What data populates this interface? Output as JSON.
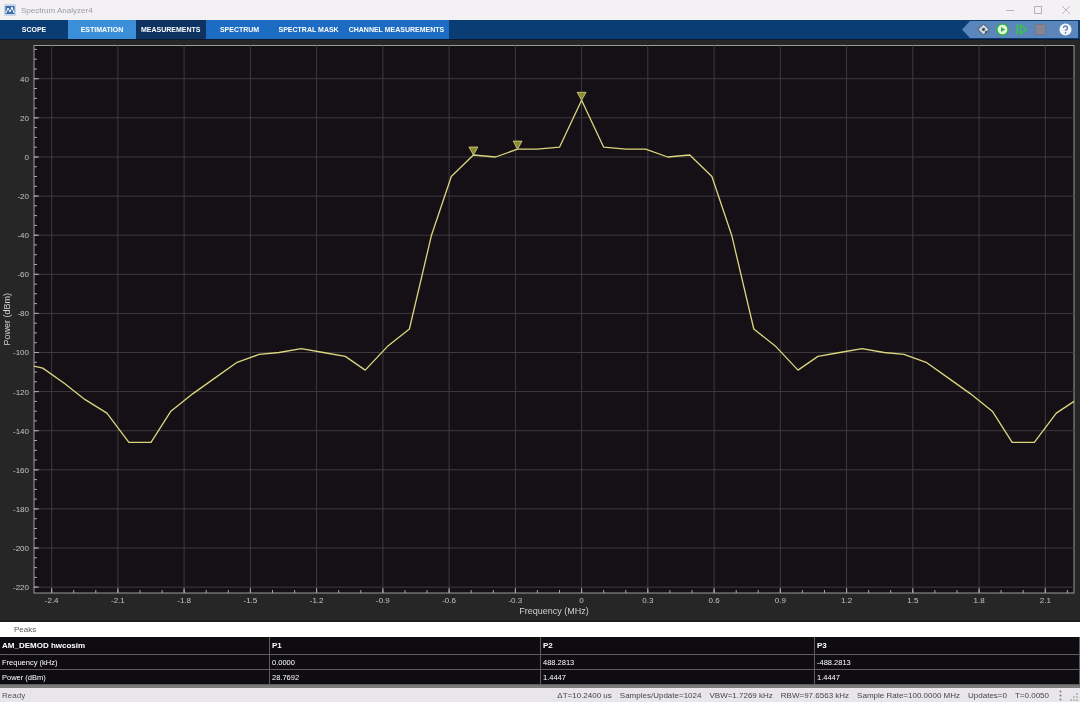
{
  "window": {
    "title": "Spectrum Analyzer4"
  },
  "toolbar": {
    "tabs": [
      {
        "label": "SCOPE",
        "kind": "main",
        "selected": false,
        "hovered": false
      },
      {
        "label": "ESTIMATION",
        "kind": "main",
        "selected": false,
        "hovered": true
      },
      {
        "label": "MEASUREMENTS",
        "kind": "main",
        "selected": true,
        "hovered": false
      },
      {
        "label": "SPECTRUM",
        "kind": "contextual",
        "selected": false,
        "hovered": false
      },
      {
        "label": "SPECTRAL MASK",
        "kind": "contextual",
        "selected": false,
        "hovered": false
      },
      {
        "label": "CHANNEL MEASUREMENTS",
        "kind": "contextual",
        "selected": false,
        "hovered": false
      }
    ],
    "buttons": [
      {
        "kind": "tools",
        "disabled": false
      },
      {
        "kind": "run",
        "disabled": false
      },
      {
        "kind": "step",
        "disabled": false
      },
      {
        "kind": "stop",
        "disabled": true
      },
      {
        "kind": "help",
        "disabled": false
      }
    ]
  },
  "plot": {
    "chart_data": {
      "type": "line",
      "xlabel": "Frequency (MHz)",
      "ylabel": "Power (dBm)",
      "grid": true,
      "x": [
        -2.48,
        -2.44,
        -2.34,
        -2.25,
        -2.15,
        -2.05,
        -1.95,
        -1.86,
        -1.76,
        -1.66,
        -1.56,
        -1.46,
        -1.37,
        -1.27,
        -1.17,
        -1.07,
        -0.98,
        -0.88,
        -0.78,
        -0.68,
        -0.59,
        -0.49,
        -0.39,
        -0.29,
        -0.2,
        -0.1,
        0,
        0.1,
        0.2,
        0.29,
        0.39,
        0.49,
        0.59,
        0.68,
        0.78,
        0.88,
        0.98,
        1.07,
        1.17,
        1.27,
        1.37,
        1.46,
        1.56,
        1.66,
        1.76,
        1.86,
        1.95,
        2.05,
        2.15,
        2.23
      ],
      "series": [
        {
          "color": "#ddd57e",
          "values": [
            -107,
            -108,
            -116,
            -124,
            -131,
            -146,
            -146,
            -130,
            -121,
            -113,
            -105,
            -101,
            -100,
            -98,
            -100,
            -102,
            -109,
            -97,
            -88,
            -40,
            -10,
            1,
            0,
            4,
            4,
            5,
            29,
            5,
            4,
            4,
            0,
            1,
            -10,
            -40,
            -88,
            -97,
            -109,
            -102,
            -100,
            -98,
            -100,
            -101,
            -105,
            -113,
            -121,
            -130,
            -146,
            -146,
            -131,
            -125
          ]
        }
      ],
      "xlim": [
        -2.48,
        2.23
      ],
      "ylim": [
        -223,
        57
      ],
      "xticks": [
        -2.4,
        -2.1,
        -1.8,
        -1.5,
        -1.2,
        -0.9,
        -0.6,
        -0.3,
        0,
        0.3,
        0.6,
        0.9,
        1.2,
        1.5,
        1.8,
        2.1
      ],
      "yticks": [
        -220,
        -200,
        -180,
        -160,
        -140,
        -120,
        -100,
        -80,
        -60,
        -40,
        -20,
        0,
        20,
        40
      ]
    }
  },
  "peaks": {
    "title": "Peaks",
    "columns": [
      "AM_DEMOD hwcosim",
      "P1",
      "P2",
      "P3"
    ],
    "rows": [
      [
        "Frequency (kHz)",
        "0.0000",
        "488.2813",
        "-488.2813"
      ],
      [
        "Power (dBm)",
        "28.7692",
        "1.4447",
        "1.4447"
      ]
    ]
  },
  "status_bar": {
    "state": "Ready",
    "items": [
      "ΔT=10.2400 us",
      "Samples/Update=1024",
      "VBW=1.7269 kHz",
      "RBW=97.6563 kHz",
      "Sample Rate=100.0000 MHz",
      "Updates=0",
      "T=0.0050"
    ]
  }
}
